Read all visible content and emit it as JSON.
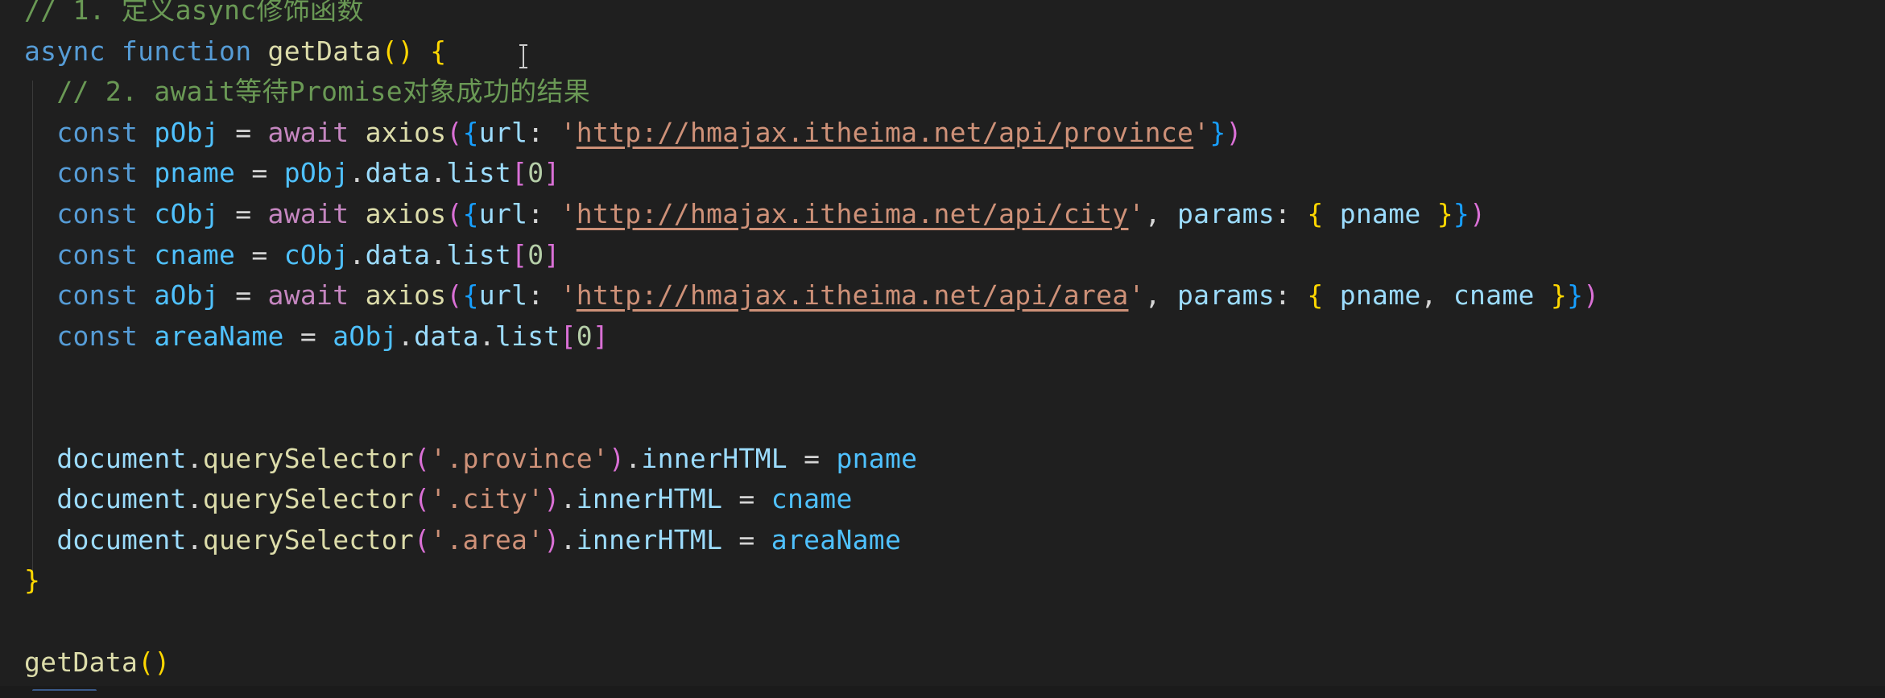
{
  "editor": {
    "lines": [
      [
        {
          "t": "// 1. 定义async修饰函数",
          "c": "tok-comment"
        }
      ],
      [
        {
          "t": "async",
          "c": "tok-keyword"
        },
        {
          "t": " ",
          "c": "tok-plain"
        },
        {
          "t": "function",
          "c": "tok-keyword"
        },
        {
          "t": " ",
          "c": "tok-plain"
        },
        {
          "t": "getData",
          "c": "tok-func"
        },
        {
          "t": "()",
          "c": "b1"
        },
        {
          "t": " ",
          "c": "tok-plain"
        },
        {
          "t": "{",
          "c": "b1"
        }
      ],
      [
        {
          "t": "  // 2. await等待Promise对象成功的结果",
          "c": "tok-comment"
        }
      ],
      [
        {
          "t": "  ",
          "c": "tok-plain"
        },
        {
          "t": "const",
          "c": "tok-keyword"
        },
        {
          "t": " ",
          "c": "tok-plain"
        },
        {
          "t": "pObj",
          "c": "tok-const"
        },
        {
          "t": " = ",
          "c": "tok-plain"
        },
        {
          "t": "await",
          "c": "tok-control"
        },
        {
          "t": " ",
          "c": "tok-plain"
        },
        {
          "t": "axios",
          "c": "tok-func"
        },
        {
          "t": "(",
          "c": "b2"
        },
        {
          "t": "{",
          "c": "b3"
        },
        {
          "t": "url",
          "c": "tok-prop"
        },
        {
          "t": ": ",
          "c": "tok-plain"
        },
        {
          "t": "'",
          "c": "tok-string"
        },
        {
          "t": "http://hmajax.itheima.net/api/province",
          "c": "tok-url"
        },
        {
          "t": "'",
          "c": "tok-string"
        },
        {
          "t": "}",
          "c": "b3"
        },
        {
          "t": ")",
          "c": "b2"
        }
      ],
      [
        {
          "t": "  ",
          "c": "tok-plain"
        },
        {
          "t": "const",
          "c": "tok-keyword"
        },
        {
          "t": " ",
          "c": "tok-plain"
        },
        {
          "t": "pname",
          "c": "tok-const"
        },
        {
          "t": " = ",
          "c": "tok-plain"
        },
        {
          "t": "pObj",
          "c": "tok-const"
        },
        {
          "t": ".",
          "c": "tok-plain"
        },
        {
          "t": "data",
          "c": "tok-prop"
        },
        {
          "t": ".",
          "c": "tok-plain"
        },
        {
          "t": "list",
          "c": "tok-prop"
        },
        {
          "t": "[",
          "c": "b2"
        },
        {
          "t": "0",
          "c": "tok-num"
        },
        {
          "t": "]",
          "c": "b2"
        }
      ],
      [
        {
          "t": "  ",
          "c": "tok-plain"
        },
        {
          "t": "const",
          "c": "tok-keyword"
        },
        {
          "t": " ",
          "c": "tok-plain"
        },
        {
          "t": "cObj",
          "c": "tok-const"
        },
        {
          "t": " = ",
          "c": "tok-plain"
        },
        {
          "t": "await",
          "c": "tok-control"
        },
        {
          "t": " ",
          "c": "tok-plain"
        },
        {
          "t": "axios",
          "c": "tok-func"
        },
        {
          "t": "(",
          "c": "b2"
        },
        {
          "t": "{",
          "c": "b3"
        },
        {
          "t": "url",
          "c": "tok-prop"
        },
        {
          "t": ": ",
          "c": "tok-plain"
        },
        {
          "t": "'",
          "c": "tok-string"
        },
        {
          "t": "http://hmajax.itheima.net/api/city",
          "c": "tok-url"
        },
        {
          "t": "'",
          "c": "tok-string"
        },
        {
          "t": ", ",
          "c": "tok-plain"
        },
        {
          "t": "params",
          "c": "tok-prop"
        },
        {
          "t": ": ",
          "c": "tok-plain"
        },
        {
          "t": "{",
          "c": "b1"
        },
        {
          "t": " ",
          "c": "tok-plain"
        },
        {
          "t": "pname",
          "c": "tok-prop"
        },
        {
          "t": " ",
          "c": "tok-plain"
        },
        {
          "t": "}",
          "c": "b1"
        },
        {
          "t": "}",
          "c": "b3"
        },
        {
          "t": ")",
          "c": "b2"
        }
      ],
      [
        {
          "t": "  ",
          "c": "tok-plain"
        },
        {
          "t": "const",
          "c": "tok-keyword"
        },
        {
          "t": " ",
          "c": "tok-plain"
        },
        {
          "t": "cname",
          "c": "tok-const"
        },
        {
          "t": " = ",
          "c": "tok-plain"
        },
        {
          "t": "cObj",
          "c": "tok-const"
        },
        {
          "t": ".",
          "c": "tok-plain"
        },
        {
          "t": "data",
          "c": "tok-prop"
        },
        {
          "t": ".",
          "c": "tok-plain"
        },
        {
          "t": "list",
          "c": "tok-prop"
        },
        {
          "t": "[",
          "c": "b2"
        },
        {
          "t": "0",
          "c": "tok-num"
        },
        {
          "t": "]",
          "c": "b2"
        }
      ],
      [
        {
          "t": "  ",
          "c": "tok-plain"
        },
        {
          "t": "const",
          "c": "tok-keyword"
        },
        {
          "t": " ",
          "c": "tok-plain"
        },
        {
          "t": "aObj",
          "c": "tok-const"
        },
        {
          "t": " = ",
          "c": "tok-plain"
        },
        {
          "t": "await",
          "c": "tok-control"
        },
        {
          "t": " ",
          "c": "tok-plain"
        },
        {
          "t": "axios",
          "c": "tok-func"
        },
        {
          "t": "(",
          "c": "b2"
        },
        {
          "t": "{",
          "c": "b3"
        },
        {
          "t": "url",
          "c": "tok-prop"
        },
        {
          "t": ": ",
          "c": "tok-plain"
        },
        {
          "t": "'",
          "c": "tok-string"
        },
        {
          "t": "http://hmajax.itheima.net/api/area",
          "c": "tok-url"
        },
        {
          "t": "'",
          "c": "tok-string"
        },
        {
          "t": ", ",
          "c": "tok-plain"
        },
        {
          "t": "params",
          "c": "tok-prop"
        },
        {
          "t": ": ",
          "c": "tok-plain"
        },
        {
          "t": "{",
          "c": "b1"
        },
        {
          "t": " ",
          "c": "tok-plain"
        },
        {
          "t": "pname",
          "c": "tok-prop"
        },
        {
          "t": ", ",
          "c": "tok-plain"
        },
        {
          "t": "cname",
          "c": "tok-prop"
        },
        {
          "t": " ",
          "c": "tok-plain"
        },
        {
          "t": "}",
          "c": "b1"
        },
        {
          "t": "}",
          "c": "b3"
        },
        {
          "t": ")",
          "c": "b2"
        }
      ],
      [
        {
          "t": "  ",
          "c": "tok-plain"
        },
        {
          "t": "const",
          "c": "tok-keyword"
        },
        {
          "t": " ",
          "c": "tok-plain"
        },
        {
          "t": "areaName",
          "c": "tok-const"
        },
        {
          "t": " = ",
          "c": "tok-plain"
        },
        {
          "t": "aObj",
          "c": "tok-const"
        },
        {
          "t": ".",
          "c": "tok-plain"
        },
        {
          "t": "data",
          "c": "tok-prop"
        },
        {
          "t": ".",
          "c": "tok-plain"
        },
        {
          "t": "list",
          "c": "tok-prop"
        },
        {
          "t": "[",
          "c": "b2"
        },
        {
          "t": "0",
          "c": "tok-num"
        },
        {
          "t": "]",
          "c": "b2"
        }
      ],
      [],
      [],
      [
        {
          "t": "  ",
          "c": "tok-plain"
        },
        {
          "t": "document",
          "c": "tok-var"
        },
        {
          "t": ".",
          "c": "tok-plain"
        },
        {
          "t": "querySelector",
          "c": "tok-func"
        },
        {
          "t": "(",
          "c": "b2"
        },
        {
          "t": "'.province'",
          "c": "tok-string"
        },
        {
          "t": ")",
          "c": "b2"
        },
        {
          "t": ".",
          "c": "tok-plain"
        },
        {
          "t": "innerHTML",
          "c": "tok-prop"
        },
        {
          "t": " = ",
          "c": "tok-plain"
        },
        {
          "t": "pname",
          "c": "tok-const"
        }
      ],
      [
        {
          "t": "  ",
          "c": "tok-plain"
        },
        {
          "t": "document",
          "c": "tok-var"
        },
        {
          "t": ".",
          "c": "tok-plain"
        },
        {
          "t": "querySelector",
          "c": "tok-func"
        },
        {
          "t": "(",
          "c": "b2"
        },
        {
          "t": "'.city'",
          "c": "tok-string"
        },
        {
          "t": ")",
          "c": "b2"
        },
        {
          "t": ".",
          "c": "tok-plain"
        },
        {
          "t": "innerHTML",
          "c": "tok-prop"
        },
        {
          "t": " = ",
          "c": "tok-plain"
        },
        {
          "t": "cname",
          "c": "tok-const"
        }
      ],
      [
        {
          "t": "  ",
          "c": "tok-plain"
        },
        {
          "t": "document",
          "c": "tok-var"
        },
        {
          "t": ".",
          "c": "tok-plain"
        },
        {
          "t": "querySelector",
          "c": "tok-func"
        },
        {
          "t": "(",
          "c": "b2"
        },
        {
          "t": "'.area'",
          "c": "tok-string"
        },
        {
          "t": ")",
          "c": "b2"
        },
        {
          "t": ".",
          "c": "tok-plain"
        },
        {
          "t": "innerHTML",
          "c": "tok-prop"
        },
        {
          "t": " = ",
          "c": "tok-plain"
        },
        {
          "t": "areaName",
          "c": "tok-const"
        }
      ],
      [
        {
          "t": "}",
          "c": "b1"
        }
      ],
      [],
      [
        {
          "t": "getData",
          "c": "tok-func"
        },
        {
          "t": "()",
          "c": "b1"
        }
      ]
    ]
  }
}
